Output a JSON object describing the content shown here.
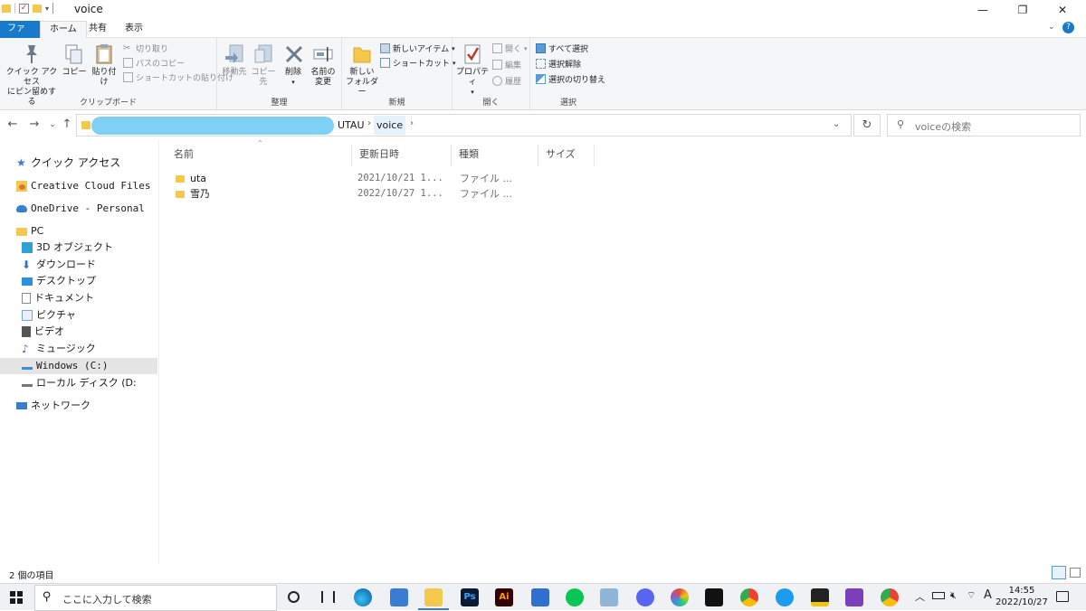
{
  "window": {
    "title": "voice",
    "minimize": "—",
    "restore": "❐",
    "close": "✕"
  },
  "menu": {
    "file": "ファイル",
    "home": "ホーム",
    "share": "共有",
    "view": "表示",
    "help": "?"
  },
  "ribbon": {
    "clipboard": {
      "label": "クリップボード",
      "pin_line1": "クイック アクセス",
      "pin_line2": "にピン留めする",
      "copy": "コピー",
      "paste": "貼り付け",
      "cut": "切り取り",
      "copy_path": "パスのコピー",
      "paste_shortcut": "ショートカットの貼り付け"
    },
    "organize": {
      "label": "整理",
      "move_to": "移動先",
      "copy_to": "コピー先",
      "delete": "削除",
      "rename_line1": "名前の",
      "rename_line2": "変更"
    },
    "new": {
      "label": "新規",
      "new_item": "新しいアイテム",
      "shortcut": "ショートカット",
      "new_folder_line1": "新しい",
      "new_folder_line2": "フォルダー"
    },
    "open": {
      "label": "開く",
      "properties": "プロパティ",
      "open": "開く",
      "edit": "編集",
      "history": "履歴"
    },
    "select": {
      "label": "選択",
      "select_all": "すべて選択",
      "select_none": "選択解除",
      "invert": "選択の切り替え"
    }
  },
  "address": {
    "crumbs": [
      "UTAU",
      "voice"
    ],
    "search_placeholder": "voiceの検索"
  },
  "nav": {
    "items": [
      {
        "label": "クイック アクセス",
        "icon": "star-icon",
        "color": "#3a7bd5"
      },
      {
        "label": "Creative Cloud Files",
        "icon": "creative-cloud-icon",
        "color": "#e0703a"
      },
      {
        "label": "OneDrive - Personal",
        "icon": "onedrive-cloud-icon",
        "color": "#3b7fd0"
      },
      {
        "label": "PC",
        "icon": "pc-folder-icon",
        "color": "#f2c94c"
      },
      {
        "label": "3D オブジェクト",
        "icon": "cube-icon",
        "color": "#32a0d8"
      },
      {
        "label": "ダウンロード",
        "icon": "download-arrow-icon",
        "color": "#2f6fcf"
      },
      {
        "label": "デスクトップ",
        "icon": "desktop-icon",
        "color": "#2d8fe0"
      },
      {
        "label": "ドキュメント",
        "icon": "document-icon",
        "color": "#8a8a8a"
      },
      {
        "label": "ピクチャ",
        "icon": "picture-icon",
        "color": "#7aa7d8"
      },
      {
        "label": "ビデオ",
        "icon": "film-icon",
        "color": "#555555"
      },
      {
        "label": "ミュージック",
        "icon": "music-note-icon",
        "color": "#2f6fcf"
      },
      {
        "label": "Windows (C:)",
        "icon": "drive-c-icon",
        "color": "#3a8fd8"
      },
      {
        "label": "ローカル ディスク (D:",
        "icon": "drive-icon",
        "color": "#777777"
      },
      {
        "label": "ネットワーク",
        "icon": "network-icon",
        "color": "#3a7bd5"
      }
    ]
  },
  "list": {
    "columns": [
      "名前",
      "更新日時",
      "種類",
      "サイズ"
    ],
    "rows": [
      {
        "name": "uta",
        "date": "2021/10/21 1...",
        "type": "ファイル ...",
        "size": ""
      },
      {
        "name": "雪乃",
        "date": "2022/10/27 1...",
        "type": "ファイル ...",
        "size": ""
      }
    ]
  },
  "status": {
    "count": "2 個の項目"
  },
  "taskbar": {
    "search_placeholder": "ここに入力して検索",
    "ps_label": "Ps",
    "ai_label": "Ai",
    "ime": "A",
    "time": "14:55",
    "date": "2022/10/27"
  }
}
